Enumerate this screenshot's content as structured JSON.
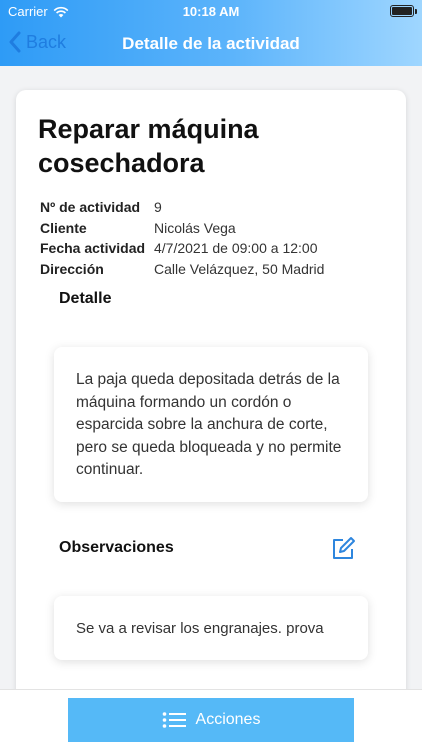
{
  "status_bar": {
    "carrier": "Carrier",
    "time": "10:18 AM"
  },
  "nav": {
    "back_label": "Back",
    "title": "Detalle de la actividad"
  },
  "activity": {
    "title": "Reparar máquina cosechadora",
    "fields": [
      {
        "label": "Nº de actividad",
        "value": "9"
      },
      {
        "label": "Cliente",
        "value": "Nicolás Vega"
      },
      {
        "label": "Fecha actividad",
        "value": "4/7/2021 de 09:00 a 12:00"
      },
      {
        "label": "Dirección",
        "value": "Calle Velázquez, 50 Madrid"
      }
    ]
  },
  "detail": {
    "heading": "Detalle",
    "text": "La paja queda depositada detrás de la máquina formando un cordón o esparcida sobre la anchura de corte, pero se queda bloqueada y no permite continuar."
  },
  "observations": {
    "heading": "Observaciones",
    "text": "Se va a revisar los engranajes. prova"
  },
  "actions_button": {
    "label": "Acciones"
  },
  "icons": {
    "back": "chevron-left-icon",
    "edit": "edit-icon",
    "actions": "list-icon",
    "wifi": "wifi-icon",
    "battery": "battery-icon"
  },
  "colors": {
    "accent": "#2e9bf6",
    "button": "#55b9f7",
    "link": "#1f7de0"
  }
}
